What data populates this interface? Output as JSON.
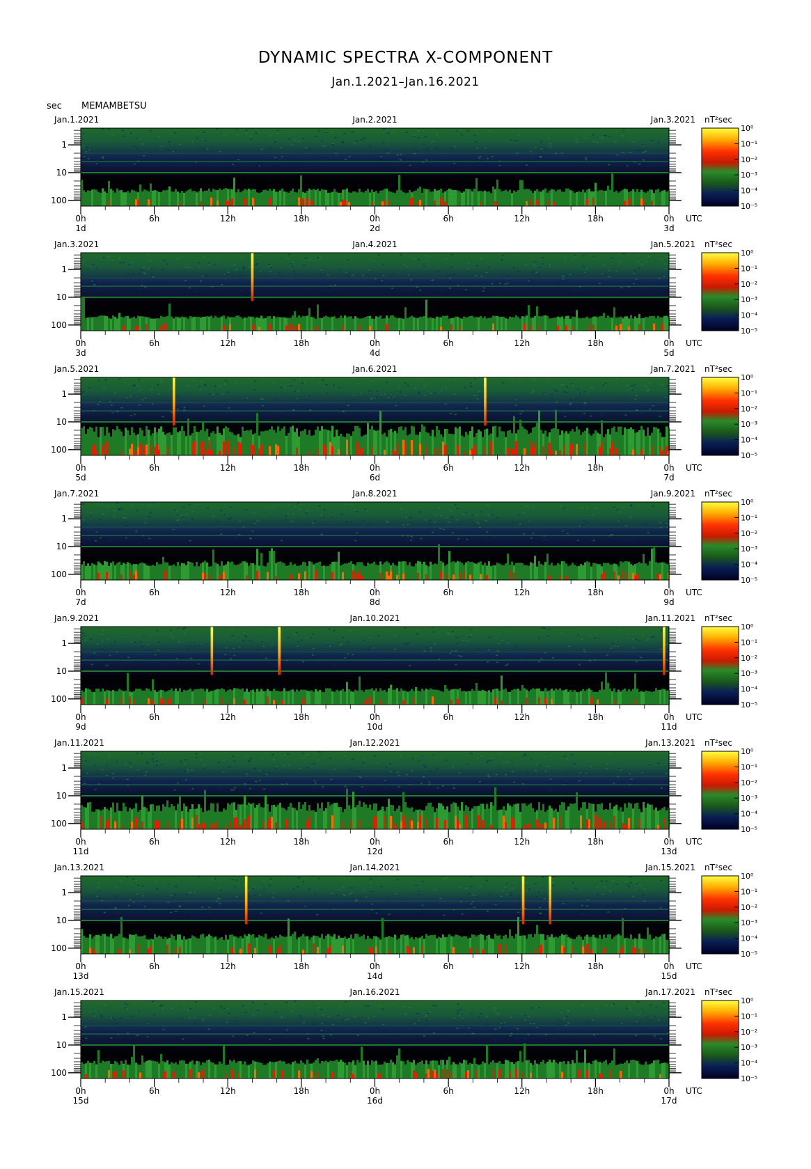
{
  "header": {
    "title": "DYNAMIC SPECTRA X-COMPONENT",
    "subtitle": "Jan.1.2021–Jan.16.2021",
    "unit_label": "sec",
    "station": "MEMAMBETSU",
    "utc_label": "UTC",
    "power_unit": "nT²sec"
  },
  "chart_data": {
    "type": "heatmap",
    "y_axis": {
      "label": "sec",
      "scale": "log",
      "range": [
        0.25,
        160
      ],
      "ticks": [
        1,
        10,
        100
      ]
    },
    "time_ticks": [
      "0h",
      "6h",
      "12h",
      "18h",
      "0h",
      "6h",
      "12h",
      "18h",
      "0h"
    ],
    "colorbar": {
      "unit": "nT²sec",
      "scale": "log",
      "range": [
        -5,
        0
      ],
      "tick_labels": [
        "10⁰",
        "10⁻¹",
        "10⁻²",
        "10⁻³",
        "10⁻⁴",
        "10⁻⁵"
      ],
      "colors": [
        "#000033",
        "#0a1f55",
        "#1a5a1a",
        "#2a8a2a",
        "#dd2200",
        "#ff7a00",
        "#ffff33"
      ]
    },
    "panels": [
      {
        "date_left": "Jan.1.2021",
        "date_mid": "Jan.2.2021",
        "date_right": "Jan.3.2021",
        "day_left": "1d",
        "day_mid": "2d",
        "day_right": "3d",
        "activity": 0.35,
        "spikes": []
      },
      {
        "date_left": "Jan.3.2021",
        "date_mid": "Jan.4.2021",
        "date_right": "Jan.5.2021",
        "day_left": "3d",
        "day_mid": "4d",
        "day_right": "5d",
        "activity": 0.25,
        "spikes": [
          {
            "hour": 14.0,
            "intensity": "strong"
          }
        ]
      },
      {
        "date_left": "Jan.5.2021",
        "date_mid": "Jan.6.2021",
        "date_right": "Jan.7.2021",
        "day_left": "5d",
        "day_mid": "6d",
        "day_right": "7d",
        "activity": 0.85,
        "spikes": [
          {
            "hour": 7.6,
            "intensity": "strong"
          },
          {
            "hour": 33.0,
            "intensity": "strong"
          }
        ]
      },
      {
        "date_left": "Jan.7.2021",
        "date_mid": "Jan.8.2021",
        "date_right": "Jan.9.2021",
        "day_left": "7d",
        "day_mid": "8d",
        "day_right": "9d",
        "activity": 0.4,
        "spikes": []
      },
      {
        "date_left": "Jan.9.2021",
        "date_mid": "Jan.10.2021",
        "date_right": "Jan.11.2021",
        "day_left": "9d",
        "day_mid": "10d",
        "day_right": "11d",
        "activity": 0.3,
        "spikes": [
          {
            "hour": 10.7,
            "intensity": "strong"
          },
          {
            "hour": 16.2,
            "intensity": "strong"
          },
          {
            "hour": 47.6,
            "intensity": "strong"
          }
        ]
      },
      {
        "date_left": "Jan.11.2021",
        "date_mid": "Jan.12.2021",
        "date_right": "Jan.13.2021",
        "day_left": "11d",
        "day_mid": "12d",
        "day_right": "13d",
        "activity": 0.75,
        "spikes": []
      },
      {
        "date_left": "Jan.13.2021",
        "date_mid": "Jan.14.2021",
        "date_right": "Jan.15.2021",
        "day_left": "13d",
        "day_mid": "14d",
        "day_right": "15d",
        "activity": 0.45,
        "spikes": [
          {
            "hour": 13.5,
            "intensity": "strong"
          },
          {
            "hour": 36.1,
            "intensity": "strong"
          },
          {
            "hour": 38.3,
            "intensity": "strong"
          }
        ]
      },
      {
        "date_left": "Jan.15.2021",
        "date_mid": "Jan.16.2021",
        "date_right": "Jan.17.2021",
        "day_left": "15d",
        "day_mid": "16d",
        "day_right": "17d",
        "activity": 0.4,
        "spikes": []
      }
    ]
  }
}
